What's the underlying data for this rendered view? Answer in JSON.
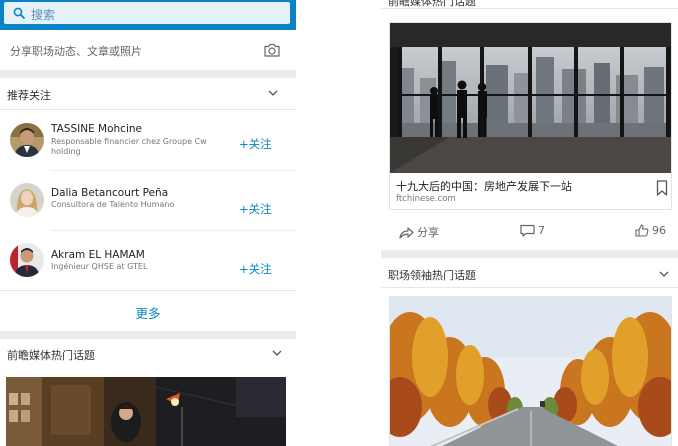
{
  "search": {
    "placeholder": "搜索"
  },
  "share": {
    "text": "分享职场动态、文章或照片"
  },
  "recommend": {
    "title": "推荐关注",
    "people": [
      {
        "name": "TASSINE Mohcine",
        "title": "Responsable financier  chez Groupe Cw holding",
        "follow": "+关注"
      },
      {
        "name": "Dalia Betancourt Peña",
        "title": "Consultora de Talento Humano",
        "follow": "+关注"
      },
      {
        "name": "Akram EL  HAMAM",
        "title": "Ingénieur QHSE at GTEL",
        "follow": "+关注"
      }
    ],
    "more": "更多"
  },
  "left_section2": {
    "title": "前瞻媒体热门话题"
  },
  "right": {
    "top_section_title": "前瞻媒体热门话题",
    "article": {
      "title": "十九大后的中国：房地产发展下一站",
      "source": "ftchinese.com"
    },
    "actions": {
      "share": "分享",
      "comments": "7",
      "likes": "96"
    },
    "section2_title": "职场领袖热门话题"
  },
  "colors": {
    "accent": "#0a84c6",
    "band": "#e9ebed"
  }
}
